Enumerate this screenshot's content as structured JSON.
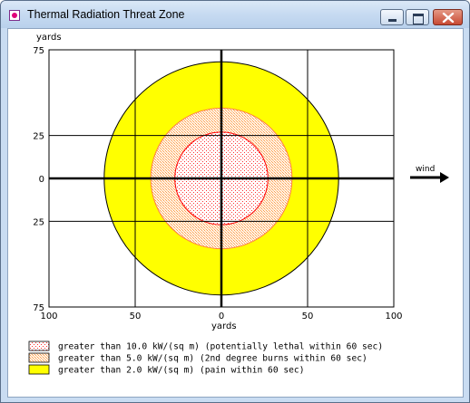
{
  "window": {
    "title": "Thermal Radiation Threat Zone",
    "icon": "app-icon"
  },
  "titlebar_buttons": [
    "minimize-icon",
    "maximize-icon",
    "close-icon"
  ],
  "chart_data": {
    "type": "threat-zone-plot",
    "y_unit_label": "yards",
    "x_unit_label": "yards",
    "y_ticks": [
      "75",
      "25",
      "0",
      "25",
      "75"
    ],
    "x_ticks": [
      "100",
      "50",
      "0",
      "50",
      "100"
    ],
    "xlim": [
      -100,
      100
    ],
    "ylim": [
      -75,
      75
    ],
    "grid": true,
    "zones": [
      {
        "name": "red",
        "radius_yards": 27,
        "color": "#ff0000",
        "pattern": "dots"
      },
      {
        "name": "orange",
        "radius_yards": 41,
        "color": "#ffb066",
        "pattern": "hatch"
      },
      {
        "name": "yellow",
        "radius_yards": 68,
        "color": "#ffff00",
        "pattern": "solid"
      }
    ],
    "wind_label": "wind",
    "legend": [
      {
        "text": "greater than 10.0 kW/(sq m) (potentially lethal within 60 sec)",
        "pattern": "dots",
        "color": "#ff0000"
      },
      {
        "text": "greater than 5.0 kW/(sq m) (2nd degree burns within 60 sec)",
        "pattern": "hatch",
        "color": "#ffb066"
      },
      {
        "text": "greater than 2.0 kW/(sq m) (pain within 60 sec)",
        "pattern": "solid",
        "color": "#ffff00"
      }
    ]
  }
}
